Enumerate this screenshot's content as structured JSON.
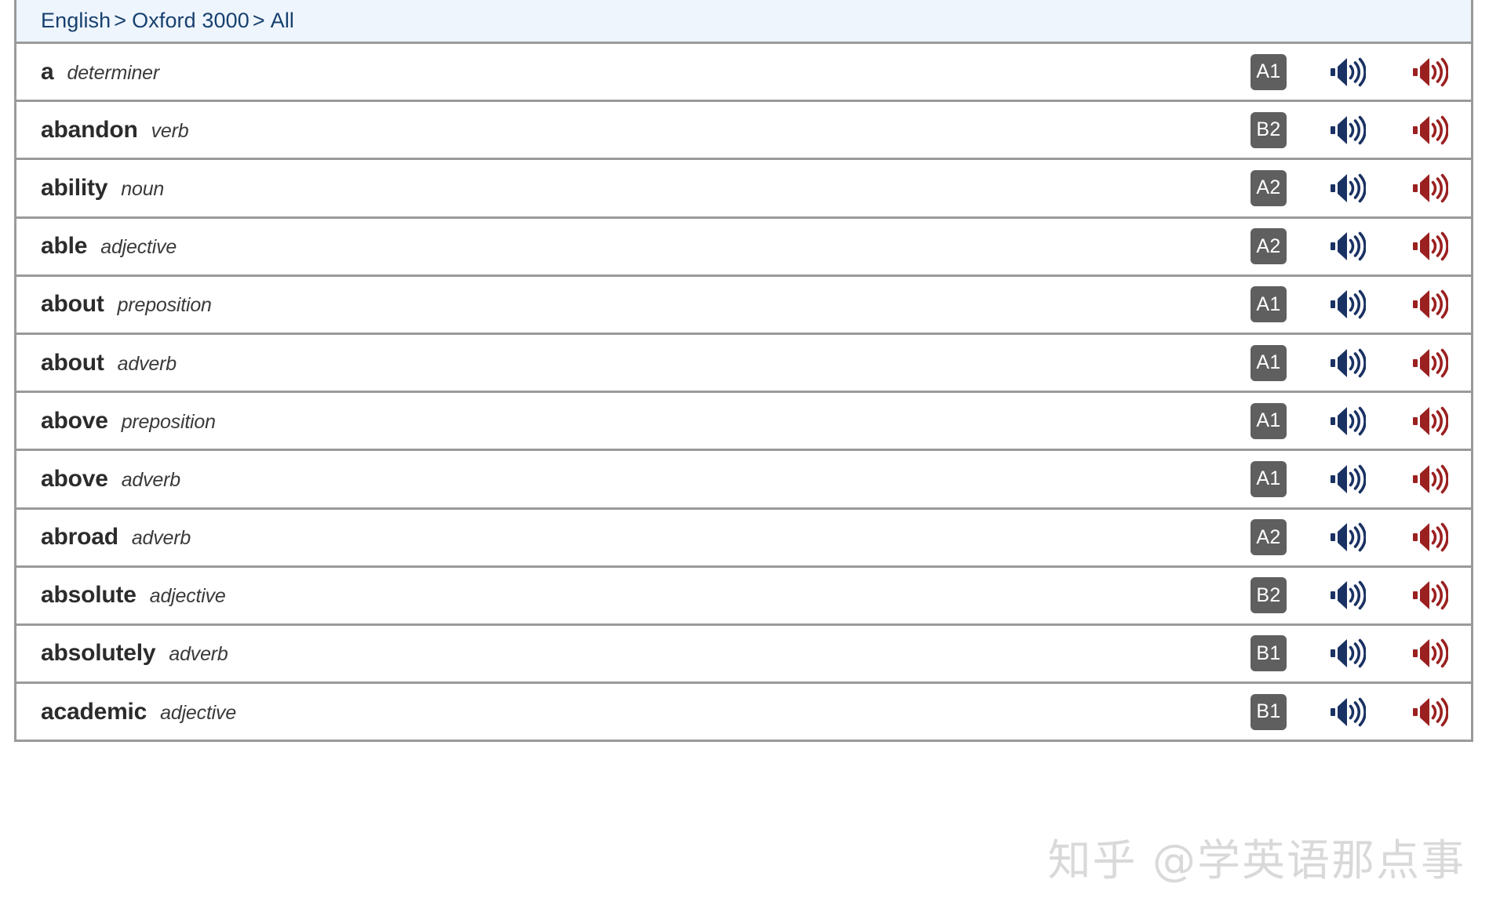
{
  "breadcrumb": {
    "items": [
      "English",
      "Oxford 3000",
      "All"
    ],
    "separator": ">"
  },
  "colors": {
    "header_background": "#eef5fd",
    "breadcrumb_text": "#17406e",
    "border": "#9a9a9a",
    "badge_background": "#5f5f5f",
    "badge_text": "#ffffff",
    "word_text": "#2b2b2b",
    "british_audio": "#1a3263",
    "american_audio": "#9b2020",
    "watermark": "#d8d8d8"
  },
  "icons": {
    "british_speaker": "speaker-icon-british",
    "american_speaker": "speaker-icon-american"
  },
  "watermark": "知乎 @学英语那点事",
  "rows": [
    {
      "word": "a",
      "pos": "determiner",
      "cefr": "A1"
    },
    {
      "word": "abandon",
      "pos": "verb",
      "cefr": "B2"
    },
    {
      "word": "ability",
      "pos": "noun",
      "cefr": "A2"
    },
    {
      "word": "able",
      "pos": "adjective",
      "cefr": "A2"
    },
    {
      "word": "about",
      "pos": "preposition",
      "cefr": "A1"
    },
    {
      "word": "about",
      "pos": "adverb",
      "cefr": "A1"
    },
    {
      "word": "above",
      "pos": "preposition",
      "cefr": "A1"
    },
    {
      "word": "above",
      "pos": "adverb",
      "cefr": "A1"
    },
    {
      "word": "abroad",
      "pos": "adverb",
      "cefr": "A2"
    },
    {
      "word": "absolute",
      "pos": "adjective",
      "cefr": "B2"
    },
    {
      "word": "absolutely",
      "pos": "adverb",
      "cefr": "B1"
    },
    {
      "word": "academic",
      "pos": "adjective",
      "cefr": "B1"
    }
  ]
}
